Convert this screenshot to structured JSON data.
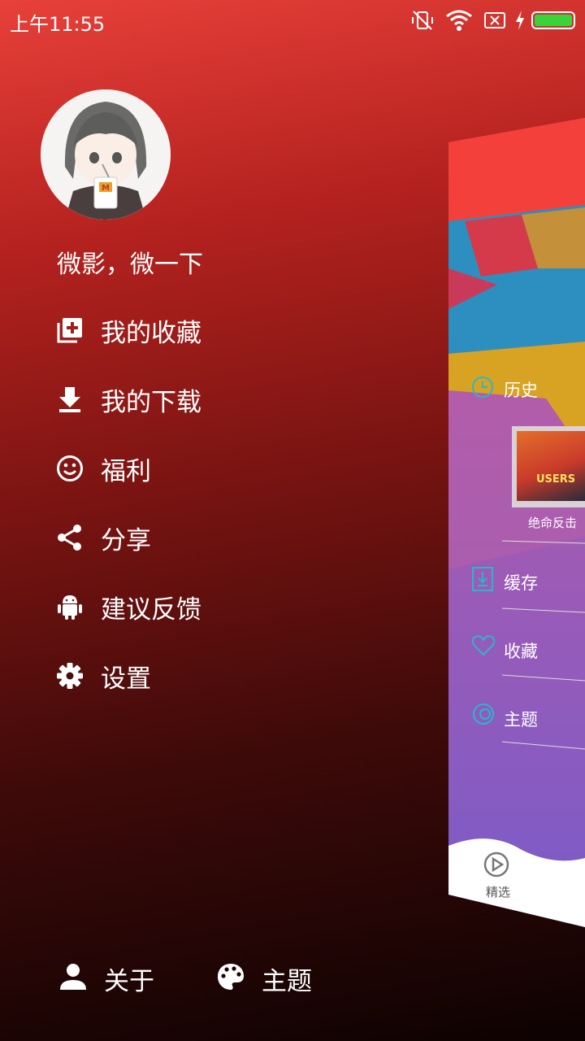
{
  "status_bar": {
    "time": "上午11:55"
  },
  "drawer": {
    "username": "微影，微一下",
    "menu": [
      {
        "label": "我的收藏",
        "icon": "library-add-icon"
      },
      {
        "label": "我的下载",
        "icon": "download-icon"
      },
      {
        "label": "福利",
        "icon": "smiley-icon"
      },
      {
        "label": "分享",
        "icon": "share-icon"
      },
      {
        "label": "建议反馈",
        "icon": "android-icon"
      },
      {
        "label": "设置",
        "icon": "gear-icon"
      }
    ],
    "bottom": [
      {
        "label": "关于",
        "icon": "person-icon"
      },
      {
        "label": "主题",
        "icon": "palette-icon"
      }
    ]
  },
  "main_panel": {
    "history_label": "历史",
    "history_item": "绝命反击",
    "poster_text": "USERS",
    "cache_label": "缓存",
    "favorites_label": "收藏",
    "theme_label": "主题",
    "tab_label": "精选"
  },
  "colors": {
    "accent_teal": "#2ab7c9",
    "header_red": "#f4403b",
    "battery_green": "#3ad33a"
  }
}
